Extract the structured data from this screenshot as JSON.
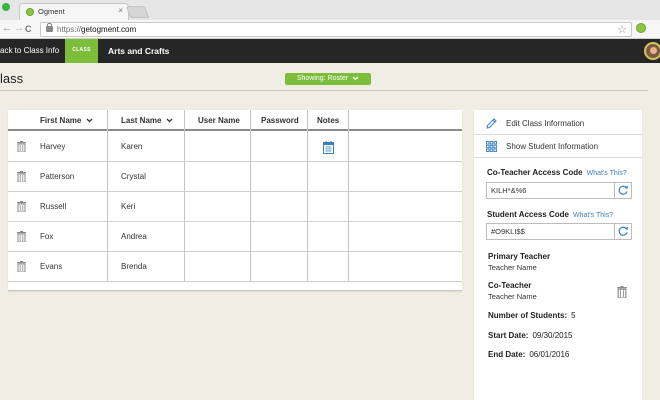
{
  "browser": {
    "tab_title": "Ogment",
    "tab_close": "×",
    "url_protocol": "https://",
    "url_host": "getogment.com",
    "star": "☆",
    "back": "←",
    "forward": "→",
    "reload": "C",
    "home": "⌂"
  },
  "navbar": {
    "back_label": "ack to Class Info",
    "class_badge": "CLASS",
    "class_name": "Arts and Crafts"
  },
  "page": {
    "title": "lass",
    "showing_label": "Showing: Roster"
  },
  "table": {
    "headers": {
      "first_name": "First Name",
      "last_name": "Last Name",
      "user_name": "User Name",
      "password": "Password",
      "notes": "Notes"
    },
    "rows": [
      {
        "first": "Harvey",
        "last": "Karen",
        "has_notes": true
      },
      {
        "first": "Patterson",
        "last": "Crystal",
        "has_notes": false
      },
      {
        "first": "Russell",
        "last": "Keri",
        "has_notes": false
      },
      {
        "first": "Fox",
        "last": "Andrea",
        "has_notes": false
      },
      {
        "first": "Evans",
        "last": "Brenda",
        "has_notes": false
      }
    ]
  },
  "panel": {
    "edit_class": "Edit Class Information",
    "show_students": "Show Student Information",
    "coteacher_code_label": "Co-Teacher Access Code",
    "whats_this": "What's This?",
    "coteacher_code": "KILH*&%6",
    "student_code_label": "Student Access Code",
    "student_code": "#O9KLI$$",
    "primary_teacher_label": "Primary Teacher",
    "primary_teacher_name": "Teacher Name",
    "coteacher_label": "Co-Teacher",
    "coteacher_name": "Teacher Name",
    "num_students_label": "Number of Students:",
    "num_students": "5",
    "start_date_label": "Start Date:",
    "start_date": "09/30/2015",
    "end_date_label": "End Date:",
    "end_date": "06/01/2016"
  },
  "colors": {
    "accent_green": "#7cbd3a",
    "navbar_bg": "#262626",
    "page_bg": "#efede4",
    "link_blue": "#3a7fc1"
  },
  "icons": {
    "trash": "trash-icon",
    "notes": "notes-icon",
    "edit": "pencil-icon",
    "students": "grid-icon",
    "refresh": "refresh-icon",
    "sort": "chevron-down-icon"
  }
}
